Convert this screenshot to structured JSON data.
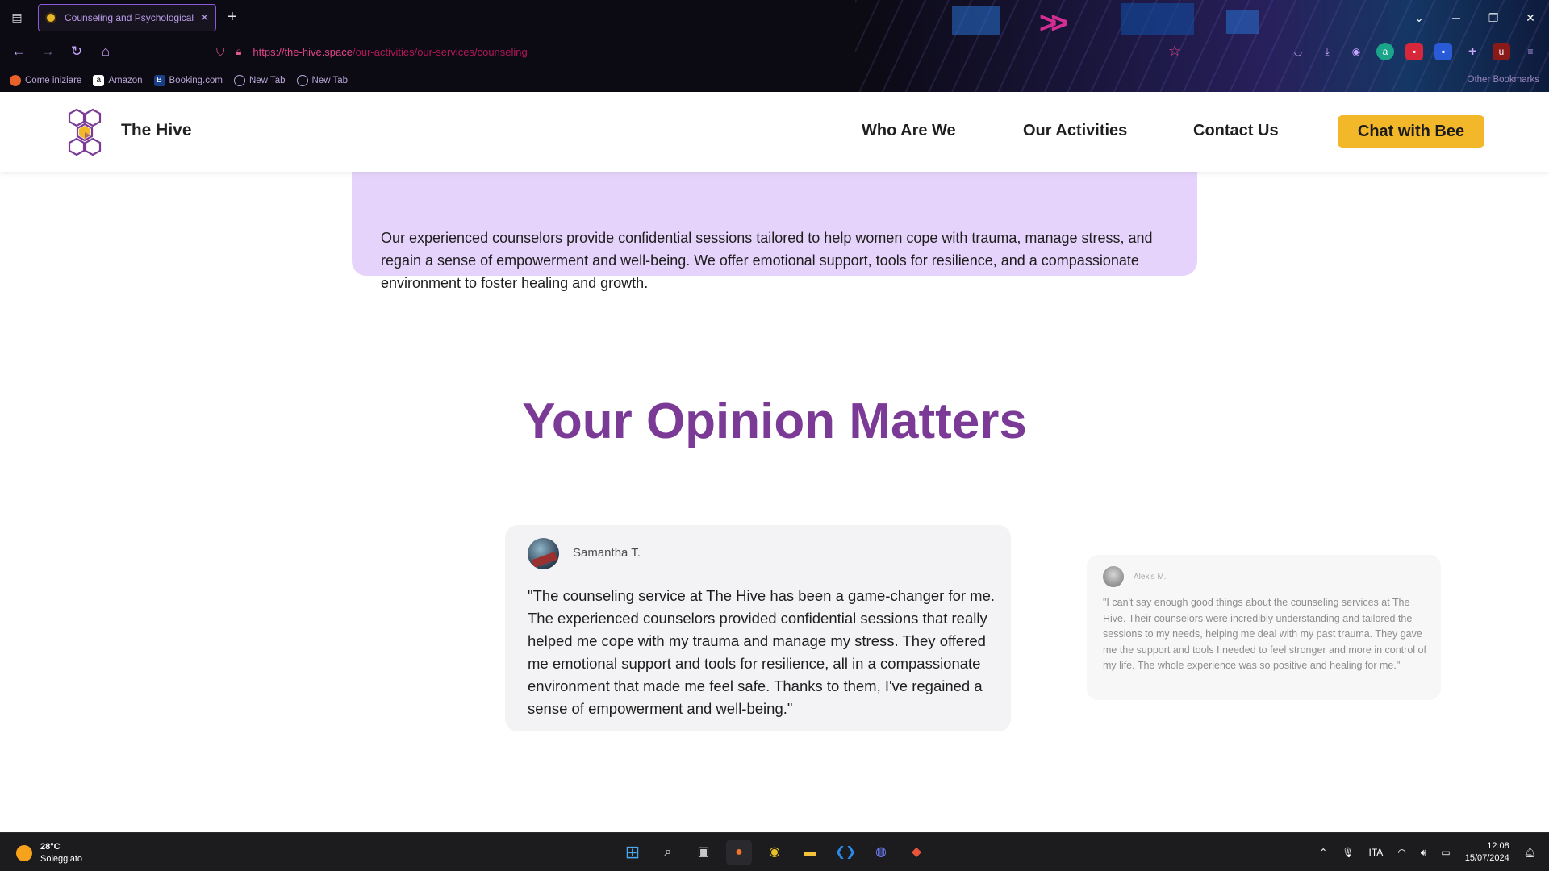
{
  "browser": {
    "tab_title": "Counseling and Psychological",
    "url_host": "https://the-hive.space",
    "url_path": "/our-activities/our-services/counseling",
    "bookmarks": [
      "Come iniziare",
      "Amazon",
      "Booking.com",
      "New Tab",
      "New Tab"
    ],
    "other_bookmarks": "Other Bookmarks"
  },
  "site": {
    "brand": "The Hive",
    "menu": [
      "Who Are We",
      "Our Activities",
      "Contact Us"
    ],
    "cta": "Chat with Bee"
  },
  "service": {
    "description": "Our experienced counselors provide confidential sessions tailored to help women cope with trauma, manage stress, and regain a sense of empowerment and well-being. We offer emotional support, tools for resilience, and a compassionate environment to foster healing and growth."
  },
  "opinion": {
    "title": "Your Opinion Matters",
    "reviews": [
      {
        "name": "Samantha T.",
        "text": "\"The counseling service at The Hive has been a game-changer for me. The experienced counselors provided confidential sessions that really helped me cope with my trauma and manage my stress. They offered me emotional support and tools for resilience, all in a compassionate environment that made me feel safe. Thanks to them, I've regained a sense of empowerment and well-being.\""
      },
      {
        "name": "Alexis M.",
        "text": "\"I can't say enough good things about the counseling services at The Hive. Their counselors were incredibly understanding and tailored the sessions to my needs, helping me deal with my past trauma. They gave me the support and tools I needed to feel stronger and more in control of my life. The whole experience was so positive and healing for me.\""
      }
    ]
  },
  "taskbar": {
    "temperature": "28°C",
    "weather": "Soleggiato",
    "language": "ITA",
    "time": "12:08",
    "date": "15/07/2024"
  },
  "colors": {
    "accent_purple": "#7a3a96",
    "card_lavender": "#e6d3fb",
    "cta_yellow": "#f2b82a"
  }
}
